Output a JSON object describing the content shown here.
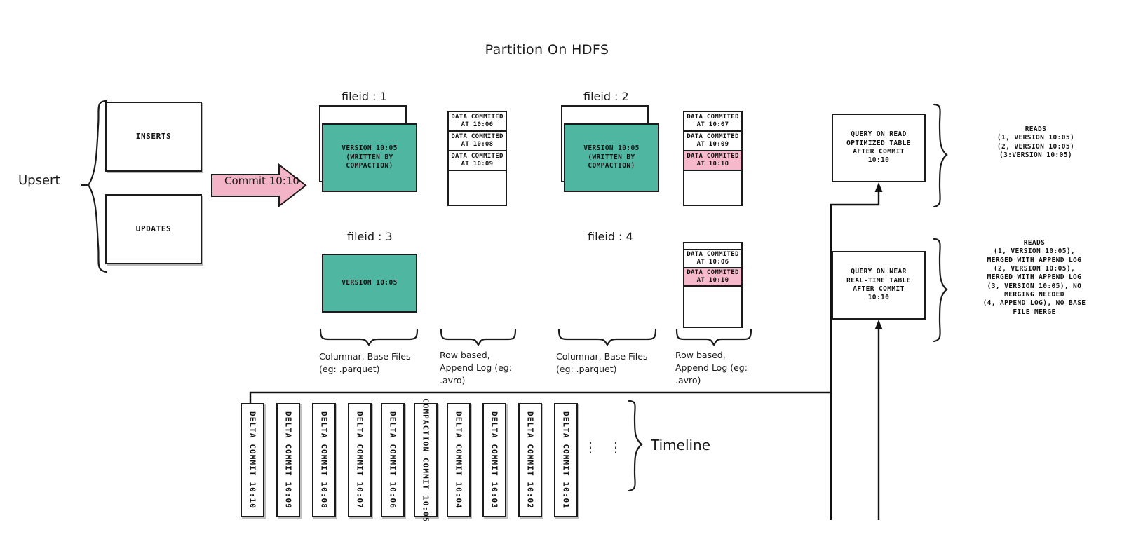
{
  "diagram": {
    "title": "Partition On HDFS",
    "upsert_label": "Upsert",
    "timeline_label": "Timeline"
  },
  "inputs": [
    {
      "label": "INSERTS"
    },
    {
      "label": "UPDATES"
    }
  ],
  "commit_arrow": {
    "label": "Commit 10:10"
  },
  "file_groups": [
    {
      "header": "fileid : 1",
      "base_file": {
        "lines": [
          "VERSION 10:05",
          "(WRITTEN BY",
          "COMPACTION)"
        ],
        "stacked": true,
        "color": "#4fb6a1"
      },
      "log_entries": [
        {
          "lines": [
            "DATA COMMITED",
            "AT 10:06"
          ],
          "highlight": false
        },
        {
          "lines": [
            "DATA COMMITED",
            "AT 10:08"
          ],
          "highlight": false
        },
        {
          "lines": [
            "DATA COMMITED",
            "AT 10:09"
          ],
          "highlight": false
        }
      ]
    },
    {
      "header": "fileid : 2",
      "base_file": {
        "lines": [
          "VERSION 10:05",
          "(WRITTEN BY",
          "COMPACTION)"
        ],
        "stacked": true,
        "color": "#4fb6a1"
      },
      "log_entries": [
        {
          "lines": [
            "DATA COMMITED",
            "AT 10:07"
          ],
          "highlight": false
        },
        {
          "lines": [
            "DATA COMMITED",
            "AT 10:09"
          ],
          "highlight": false
        },
        {
          "lines": [
            "DATA COMMITED",
            "AT 10:10"
          ],
          "highlight": true
        }
      ]
    },
    {
      "header": "fileid : 3",
      "base_file": {
        "lines": [
          "VERSION 10:05"
        ],
        "stacked": false,
        "color": "#4fb6a1"
      },
      "log_entries": []
    },
    {
      "header": "fileid : 4",
      "base_file": null,
      "log_entries": [
        {
          "lines": [
            "DATA COMMITED",
            "AT 10:06"
          ],
          "highlight": false
        },
        {
          "lines": [
            "DATA COMMITED",
            "AT 10:10"
          ],
          "highlight": true
        }
      ]
    }
  ],
  "brace_captions": [
    {
      "lines": [
        "Columnar, Base Files",
        "(eg: .parquet)"
      ]
    },
    {
      "lines": [
        "Row based,",
        "Append Log  (eg:",
        ".avro)"
      ]
    },
    {
      "lines": [
        "Columnar, Base Files",
        "(eg: .parquet)"
      ]
    },
    {
      "lines": [
        "Row based,",
        "Append Log  (eg:",
        ".avro)"
      ]
    }
  ],
  "queries": [
    {
      "box_lines": [
        "QUERY ON READ",
        "OPTIMIZED TABLE",
        "AFTER COMMIT",
        "10:10"
      ],
      "reads_lines": [
        "READS",
        "(1, VERSION 10:05)",
        "(2, VERSION 10:05)",
        "(3:VERSION 10:05)"
      ]
    },
    {
      "box_lines": [
        "QUERY ON NEAR",
        "REAL-TIME TABLE",
        "AFTER COMMIT",
        "10:10"
      ],
      "reads_lines": [
        "READS",
        "(1, VERSION 10:05),",
        "MERGED WITH APPEND LOG",
        "(2, VERSION 10:05),",
        "MERGED WITH APPEND LOG",
        "(3, VERSION 10:05), NO",
        "MERGING NEEDED",
        "(4, APPEND LOG), NO BASE",
        "FILE MERGE"
      ]
    }
  ],
  "timeline": {
    "cards": [
      {
        "label": "DELTA COMMIT  10:10",
        "highlight": false
      },
      {
        "label": "DELTA COMMIT  10:09",
        "highlight": false
      },
      {
        "label": "DELTA COMMIT  10:08",
        "highlight": false
      },
      {
        "label": "DELTA COMMIT  10:07",
        "highlight": false
      },
      {
        "label": "DELTA COMMIT  10:06",
        "highlight": false
      },
      {
        "label": "COMPACTION COMMIT 10:05",
        "highlight": true
      },
      {
        "label": "DELTA COMMIT  10:04",
        "highlight": false
      },
      {
        "label": "DELTA COMMIT  10:03",
        "highlight": false
      },
      {
        "label": "DELTA COMMIT  10:02",
        "highlight": false
      },
      {
        "label": "DELTA COMMIT  10:01",
        "highlight": false
      }
    ],
    "ellipsis": [
      "⋮",
      "⋮"
    ],
    "label": "Timeline"
  },
  "colors": {
    "base_green": "#4fb6a1",
    "highlight_pink": "#f6b9cb",
    "arrow_pink": "#f4b4c8",
    "stroke": "#1b1b1b"
  }
}
